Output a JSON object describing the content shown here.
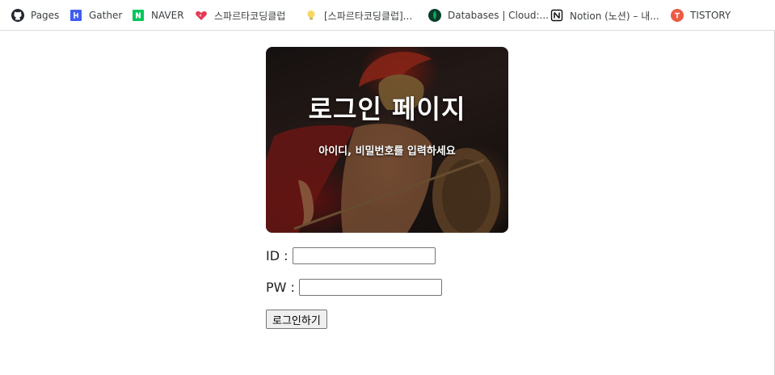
{
  "bookmarks": [
    {
      "label": "Pages",
      "icon": "github-icon"
    },
    {
      "label": "Gather",
      "icon": "gather-icon"
    },
    {
      "label": "NAVER",
      "icon": "naver-icon"
    },
    {
      "label": "스파르타코딩클럽",
      "icon": "heart-icon"
    },
    {
      "label": "[스파르타코딩클럽]...",
      "icon": "lightbulb-icon"
    },
    {
      "label": "Databases | Cloud:...",
      "icon": "mongodb-leaf-icon"
    },
    {
      "label": "Notion (노션) – 내...",
      "icon": "notion-icon"
    },
    {
      "label": "TISTORY",
      "icon": "tistory-icon"
    }
  ],
  "hero": {
    "title": "로그인 페이지",
    "subtitle": "아이디, 비밀번호를 입력하세요"
  },
  "form": {
    "id_label": "ID :",
    "id_value": "",
    "pw_label": "PW :",
    "pw_value": "",
    "login_button": "로그인하기"
  },
  "colors": {
    "naver": "#03c75a",
    "gather": "#3f5df2",
    "tistory": "#eb5b43",
    "heart": "#e53a55"
  }
}
